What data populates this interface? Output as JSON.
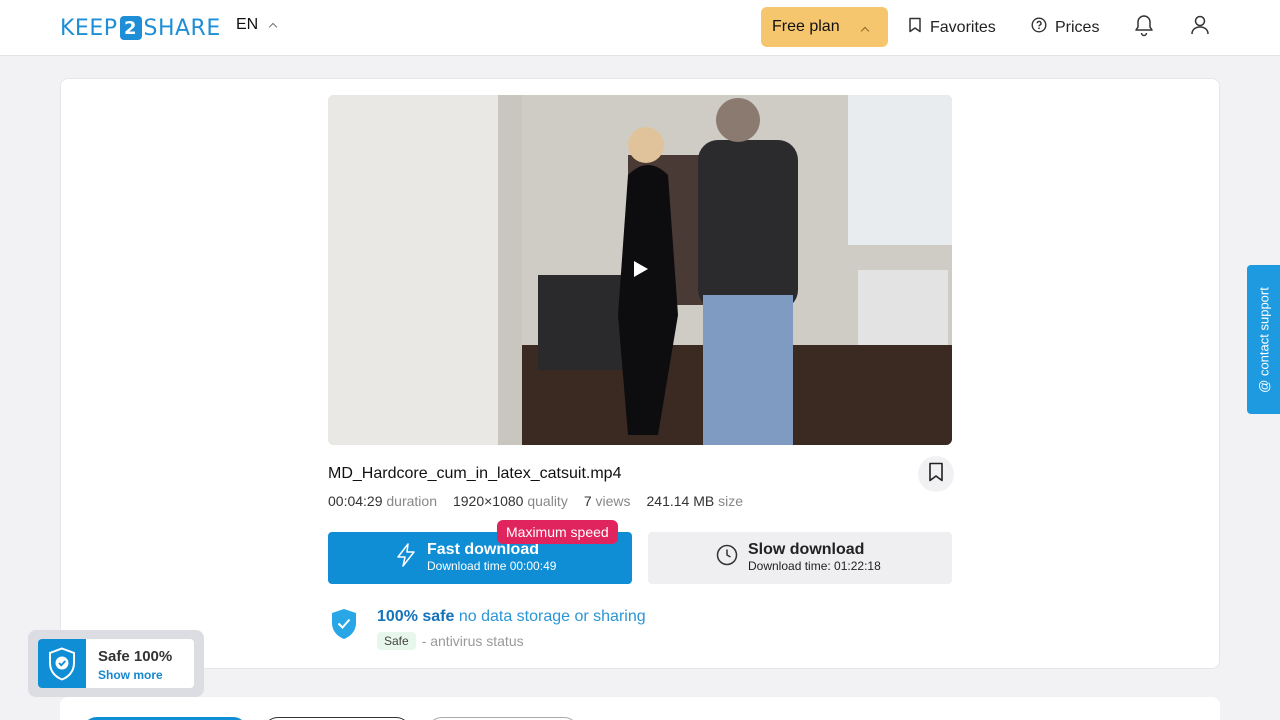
{
  "header": {
    "logo": {
      "left": "KEEP",
      "mid": "2",
      "right": "SHARE"
    },
    "language": "EN",
    "plan_label": "Free plan",
    "favorites_label": "Favorites",
    "prices_label": "Prices"
  },
  "file": {
    "name": "MD_Hardcore_cum_in_latex_catsuit.mp4",
    "duration": "00:04:29",
    "duration_label": "duration",
    "quality": "1920×1080",
    "quality_label": "quality",
    "views": "7",
    "views_label": "views",
    "size": "241.14 MB",
    "size_label": "size"
  },
  "download": {
    "fast_label": "Fast download",
    "fast_sub": "Download time 00:00:49",
    "badge": "Maximum speed",
    "slow_label": "Slow download",
    "slow_sub": "Download time: 01:22:18"
  },
  "safety": {
    "headline_strong": "100% safe",
    "headline_light": "no data storage or sharing",
    "chip": "Safe",
    "antivirus": "- antivirus status"
  },
  "widget": {
    "title": "Safe 100%",
    "more": "Show more"
  },
  "contact_support": "@ contact support",
  "colors": {
    "brand": "#1e8fd6",
    "plan": "#f6c66e",
    "fast": "#0f8ed6",
    "badge": "#e0245e",
    "contact": "#1e9ae0"
  }
}
